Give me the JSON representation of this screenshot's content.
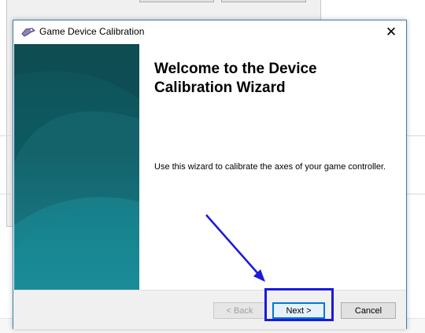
{
  "dialog": {
    "title": "Game Device Calibration",
    "close_glyph": "✕",
    "heading": "Welcome to the Device Calibration Wizard",
    "description": "Use this wizard to calibrate the axes of your game controller."
  },
  "footer": {
    "back_label": "< Back",
    "next_label": "Next >",
    "cancel_label": "Cancel",
    "back_enabled": false
  },
  "annotation": {
    "highlight_color": "#1a1adb",
    "target": "next-button"
  },
  "icons": [
    "game-controller-icon",
    "close-icon"
  ]
}
